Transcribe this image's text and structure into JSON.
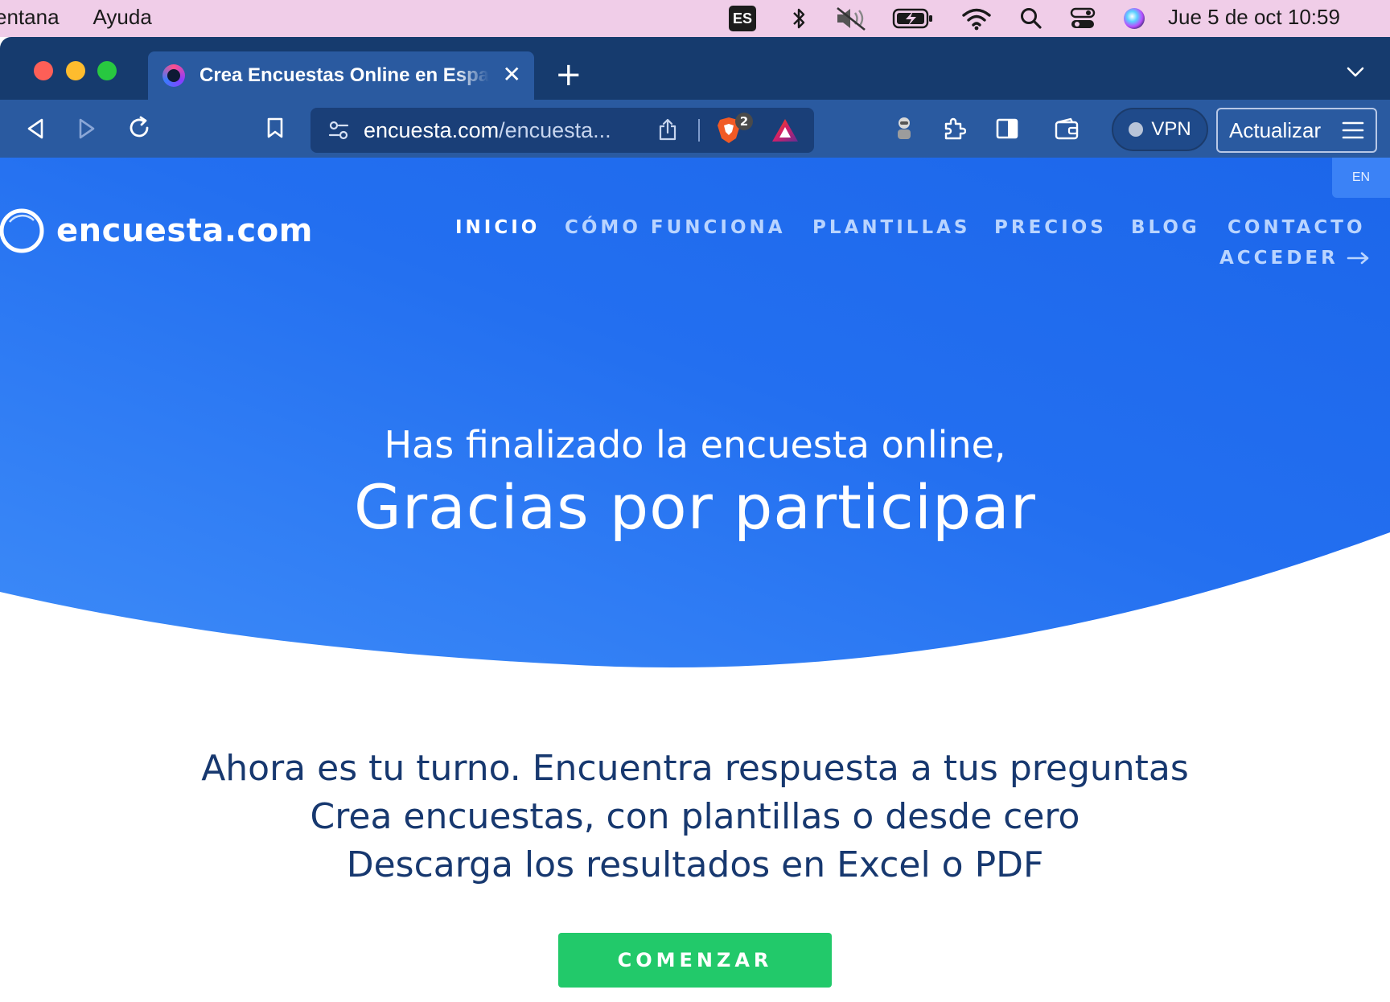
{
  "menubar": {
    "items": [
      "entana",
      "Ayuda"
    ],
    "input_source": "ES",
    "clock": "Jue 5 de oct  10:59"
  },
  "browser": {
    "tab_title": "Crea Encuestas Online en Español",
    "url_domain": "encuesta.com",
    "url_path": "/encuesta...",
    "brave_shields_count": "2",
    "vpn_label": "VPN",
    "update_label": "Actualizar"
  },
  "site": {
    "language_toggle": "EN",
    "logo_text": "encuesta.com",
    "nav": {
      "inicio": "INICIO",
      "como_funciona": "CÓMO FUNCIONA",
      "plantillas": "PLANTILLAS",
      "precios": "PRECIOS",
      "blog": "BLOG",
      "contacto": "CONTACTO",
      "acceder": "ACCEDER"
    },
    "hero": {
      "subtitle": "Has finalizado la encuesta online,",
      "title": "Gracias por participar"
    },
    "pitch": {
      "line1": "Ahora es tu turno. Encuentra respuesta a tus preguntas",
      "line2": "Crea encuestas, con plantillas o desde cero",
      "line3": "Descarga los resultados en Excel o PDF"
    },
    "cta_label": "COMENZAR"
  },
  "colors": {
    "hero_blue": "#1f6ff0",
    "nav_inactive": "#b9d4ff",
    "pitch_text": "#17386f",
    "cta_green": "#22c96a",
    "chrome_dark": "#163b6e",
    "chrome_toolbar": "#2a5aa0"
  }
}
